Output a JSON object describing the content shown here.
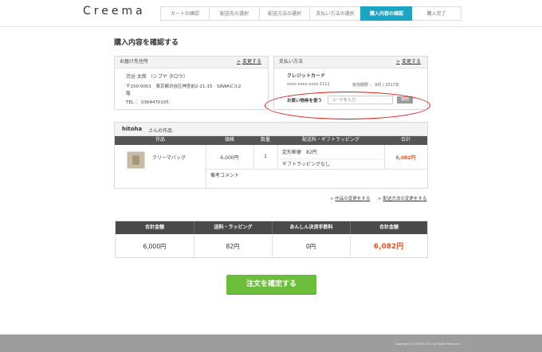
{
  "header": {
    "logo": "Creema",
    "steps": [
      "カートの確認",
      "配送先の選択",
      "配送方法の選択",
      "支払い方法の選択",
      "購入内容の確認",
      "購入完了"
    ],
    "active_step": 4
  },
  "page_title": "購入内容を確認する",
  "shipping": {
    "title": "お届け先住所",
    "change": "変更する",
    "name": "渋谷 太郎 （シブヤ タロウ）",
    "address": "〒150-0001　東京都渋谷区神宮前2-21-15　SAWAビル2",
    "address2": "階",
    "tel": "TEL ： 0364470105"
  },
  "payment": {
    "title": "支払い方法",
    "change": "変更する",
    "method": "クレジットカード",
    "card_number": "xxxx-xxxx-xxxx-1111",
    "expiry": "有効期限 ： 9月 / 2017年",
    "coupon_label": "お買い物券を使う",
    "coupon_placeholder": "コードを入力",
    "coupon_button": "適用"
  },
  "order": {
    "shop_name": "hitoha",
    "shop_suffix": " さんの作品",
    "columns": [
      "作品",
      "価格",
      "数量",
      "配送料・ギフトラッピング",
      "合計"
    ],
    "item": {
      "name": "クリーマバッグ",
      "price": "6,000円",
      "qty": "1",
      "shipping_method": "定形郵便　82円",
      "gift": "ギフトラッピングなし",
      "total": "6,082円"
    },
    "remarks_label": "備考コメント",
    "change_item": "作品の変更をする",
    "change_shipping": "配送方法の変更をする"
  },
  "totals": {
    "headers": [
      "合計金額",
      "送料・ラッピング",
      "あんしん決済手数料",
      "合計金額"
    ],
    "values": [
      "6,000円",
      "82円",
      "0円",
      "6,082円"
    ]
  },
  "confirm_button": "注文を確定する",
  "copyright": "Copyright © CREEMA LTD. All Rights Reserved.",
  "colors": {
    "accent": "#1da4c2",
    "confirm": "#6cbe3a",
    "price": "#e8542a",
    "annotation": "#e01010"
  }
}
